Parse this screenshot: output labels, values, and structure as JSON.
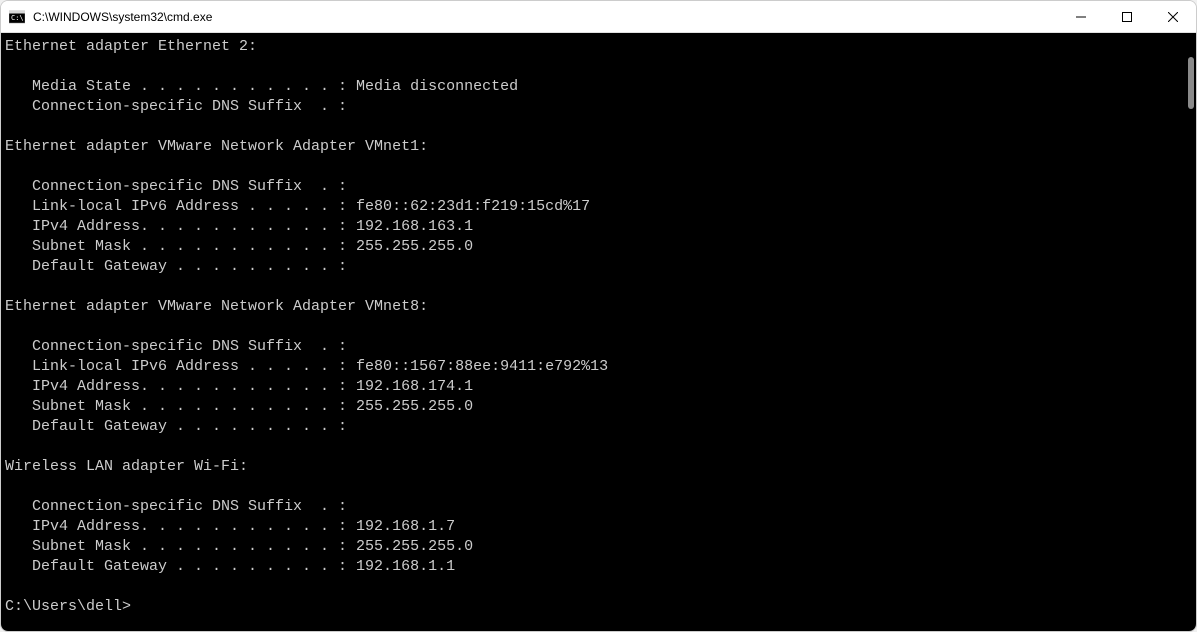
{
  "window": {
    "title": "C:\\WINDOWS\\system32\\cmd.exe"
  },
  "terminal": {
    "content": "Ethernet adapter Ethernet 2:\n\n   Media State . . . . . . . . . . . : Media disconnected\n   Connection-specific DNS Suffix  . :\n\nEthernet adapter VMware Network Adapter VMnet1:\n\n   Connection-specific DNS Suffix  . :\n   Link-local IPv6 Address . . . . . : fe80::62:23d1:f219:15cd%17\n   IPv4 Address. . . . . . . . . . . : 192.168.163.1\n   Subnet Mask . . . . . . . . . . . : 255.255.255.0\n   Default Gateway . . . . . . . . . :\n\nEthernet adapter VMware Network Adapter VMnet8:\n\n   Connection-specific DNS Suffix  . :\n   Link-local IPv6 Address . . . . . : fe80::1567:88ee:9411:e792%13\n   IPv4 Address. . . . . . . . . . . : 192.168.174.1\n   Subnet Mask . . . . . . . . . . . : 255.255.255.0\n   Default Gateway . . . . . . . . . :\n\nWireless LAN adapter Wi-Fi:\n\n   Connection-specific DNS Suffix  . :\n   IPv4 Address. . . . . . . . . . . : 192.168.1.7\n   Subnet Mask . . . . . . . . . . . : 255.255.255.0\n   Default Gateway . . . . . . . . . : 192.168.1.1\n\nC:\\Users\\dell>"
  }
}
